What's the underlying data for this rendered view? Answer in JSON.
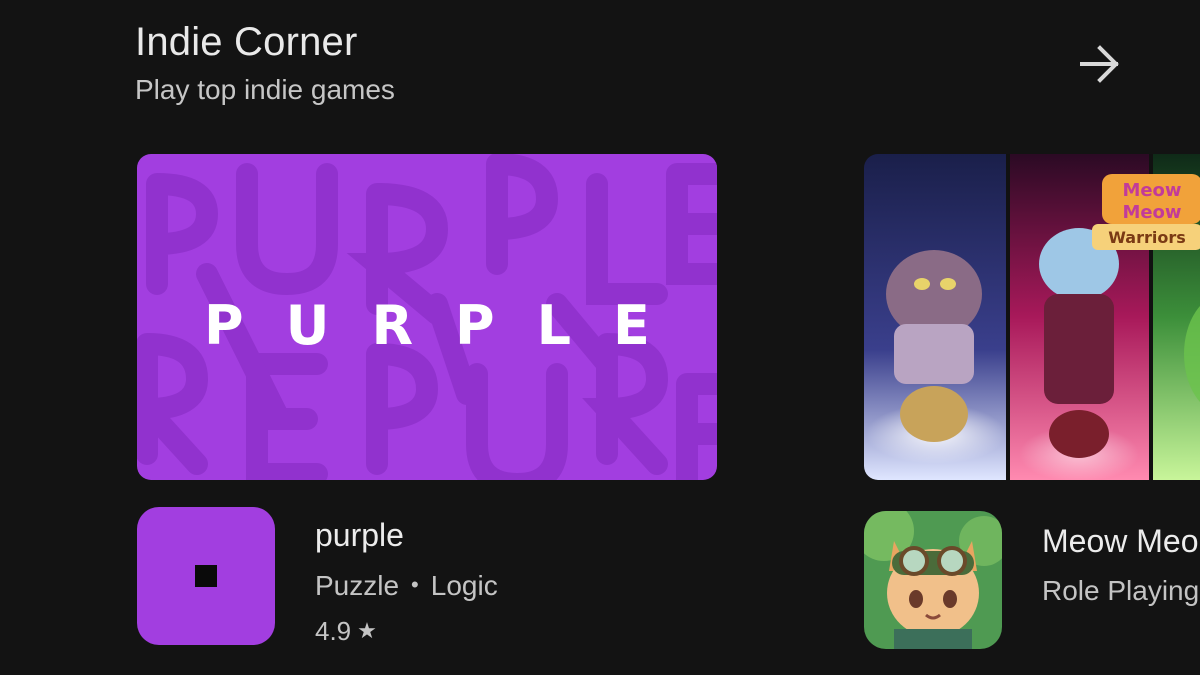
{
  "section": {
    "title": "Indie Corner",
    "subtitle": "Play top indie games",
    "more_icon": "arrow-right-icon"
  },
  "apps": [
    {
      "banner_text": "PURPLE",
      "banner_color": "#a23ee0",
      "name": "purple",
      "category1": "Puzzle",
      "separator": "•",
      "category2": "Logic",
      "rating": "4.9",
      "rating_icon": "star-icon",
      "icon_color": "#a23ee0"
    },
    {
      "banner_logo": "Meow Meow Warriors",
      "name": "Meow Meo",
      "category1": "Role Playing"
    }
  ],
  "colors": {
    "background": "#131313",
    "purple": "#a23ee0"
  }
}
